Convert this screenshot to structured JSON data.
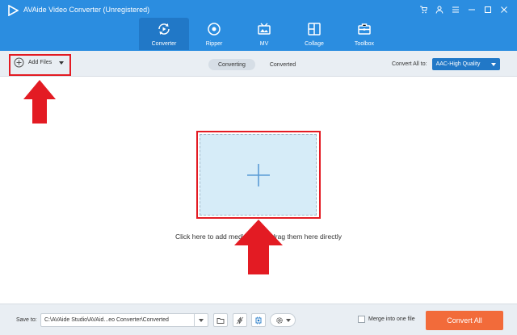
{
  "app": {
    "title": "AVAide Video Converter (Unregistered)",
    "logo_icon": "play-logo-icon"
  },
  "window_controls": [
    "cart-icon",
    "user-icon",
    "menu-icon",
    "minimize-icon",
    "maximize-icon",
    "close-icon"
  ],
  "nav": {
    "items": [
      {
        "label": "Converter",
        "icon": "converter-icon",
        "active": true
      },
      {
        "label": "Ripper",
        "icon": "ripper-icon",
        "active": false
      },
      {
        "label": "MV",
        "icon": "mv-icon",
        "active": false
      },
      {
        "label": "Collage",
        "icon": "collage-icon",
        "active": false
      },
      {
        "label": "Toolbox",
        "icon": "toolbox-icon",
        "active": false
      }
    ]
  },
  "toolbar": {
    "add_files_label": "Add Files",
    "tabs": [
      {
        "label": "Converting",
        "active": true
      },
      {
        "label": "Converted",
        "active": false
      }
    ],
    "convert_all_label": "Convert All to:",
    "convert_all_value": "AAC-High Quality"
  },
  "main": {
    "hint": "Click here to add media files or drag them here directly"
  },
  "bottom": {
    "save_to_label": "Save to:",
    "save_path": "C:\\AVAide Studio\\AVAid...eo Converter\\Converted",
    "merge_label": "Merge into one file",
    "convert_all_button": "Convert All"
  },
  "colors": {
    "titlebar": "#2b8de0",
    "active_nav": "#2178c7",
    "convert_button": "#f26b3a",
    "annotation": "#e31b23",
    "dropzone": "#d6ecf8"
  }
}
